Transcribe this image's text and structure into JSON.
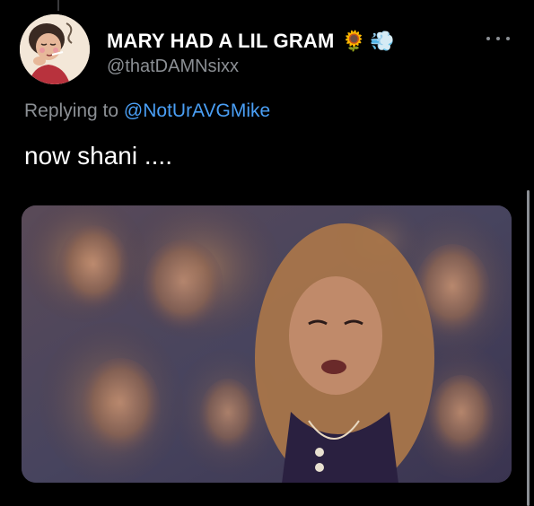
{
  "tweet": {
    "display_name": "MARY HAD A LIL GRAM",
    "name_emojis": [
      "🌻",
      "💨"
    ],
    "handle": "@thatDAMNsixx",
    "replying_prefix": "Replying to",
    "replying_to": "@NotUrAVGMike",
    "text": "now shani ....",
    "avatar_icon": "cartoon-woman-avatar-icon",
    "more_icon": "more-options-icon",
    "media_description_icon": "meme-collage-image"
  },
  "colors": {
    "background": "#000000",
    "primary_text": "#ffffff",
    "secondary_text": "#8b8f94",
    "link": "#4a9ff5"
  }
}
